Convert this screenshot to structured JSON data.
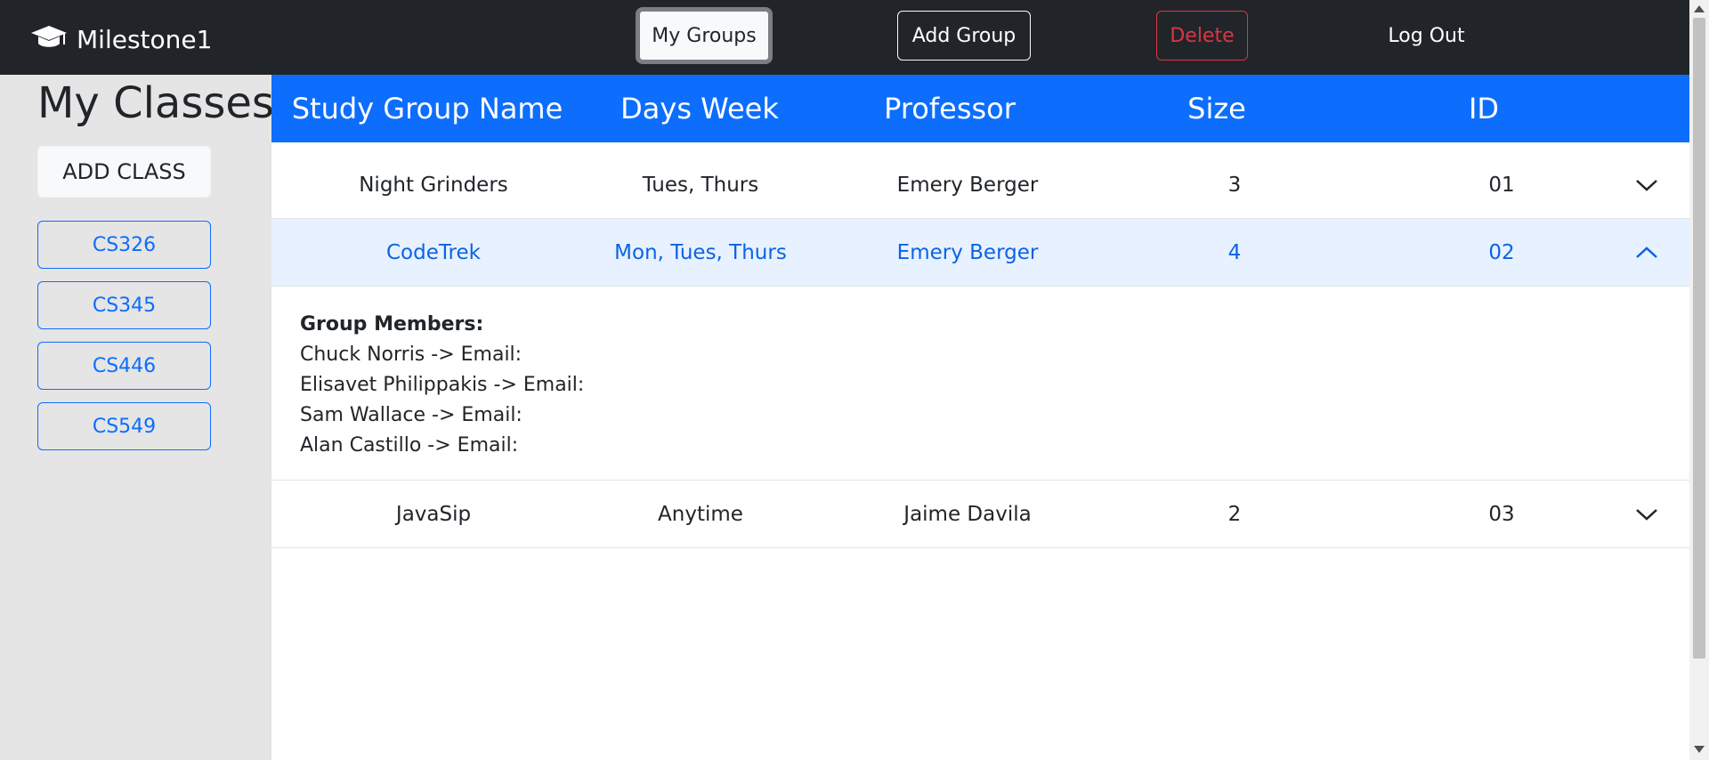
{
  "navbar": {
    "brand": "Milestone1",
    "brand_icon": "graduation-cap-icon",
    "buttons": {
      "my_groups": "My Groups",
      "add_group": "Add Group",
      "delete": "Delete",
      "log_out": "Log Out"
    }
  },
  "sidebar": {
    "title": "My Classes",
    "add_class": "ADD CLASS",
    "classes": [
      "CS326",
      "CS345",
      "CS446",
      "CS549"
    ]
  },
  "table": {
    "headers": [
      "Study Group Name",
      "Days Week",
      "Professor",
      "Size",
      "ID"
    ],
    "rows": [
      {
        "name": "Night Grinders",
        "days": "Tues, Thurs",
        "professor": "Emery Berger",
        "size": "3",
        "id": "01",
        "expanded": false
      },
      {
        "name": "CodeTrek",
        "days": "Mon, Tues, Thurs",
        "professor": "Emery Berger",
        "size": "4",
        "id": "02",
        "expanded": true
      },
      {
        "name": "JavaSip",
        "days": "Anytime",
        "professor": "Jaime Davila",
        "size": "2",
        "id": "03",
        "expanded": false
      }
    ],
    "details": {
      "heading": "Group Members:",
      "members": [
        "Chuck Norris -> Email:",
        "Elisavet Philippakis -> Email:",
        "Sam Wallace -> Email:",
        "Alan Castillo -> Email:"
      ]
    }
  },
  "colors": {
    "navbar_bg": "#212529",
    "primary": "#0d6efd",
    "danger": "#dc3545",
    "sidebar_bg": "#e5e5e5",
    "active_row_bg": "#e7f1ff"
  }
}
